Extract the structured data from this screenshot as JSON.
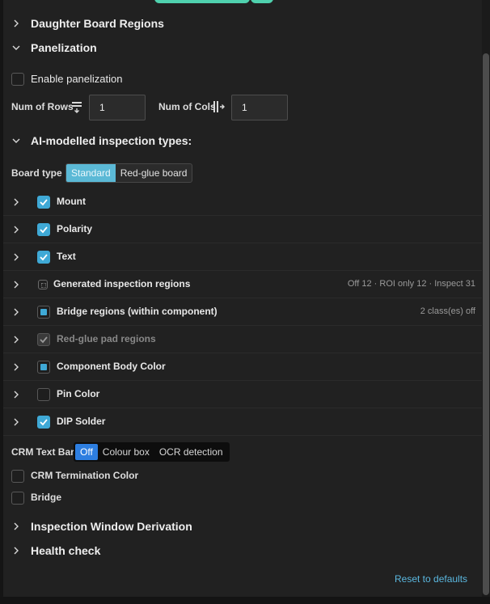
{
  "sections": {
    "daughter_board": "Daughter Board Regions",
    "panelization": "Panelization",
    "ai_types": "AI-modelled inspection types:",
    "inspection_window": "Inspection Window Derivation",
    "health_check": "Health check"
  },
  "panelization": {
    "enable_label": "Enable panelization",
    "rows_label": "Num of Rows",
    "rows_value": "1",
    "cols_label": "Num of Cols",
    "cols_value": "1"
  },
  "board_type": {
    "label": "Board type",
    "options": [
      "Standard",
      "Red-glue board"
    ],
    "selected": "Standard"
  },
  "inspection_rows": [
    {
      "label": "Mount",
      "state": "checked",
      "meta": ""
    },
    {
      "label": "Polarity",
      "state": "checked",
      "meta": ""
    },
    {
      "label": "Text",
      "state": "checked",
      "meta": ""
    },
    {
      "label": "Generated inspection regions",
      "state": "dotted",
      "meta": "Off 12 · ROI only 12 · Inspect 31"
    },
    {
      "label": "Bridge regions (within component)",
      "state": "partial",
      "meta": "2 class(es) off"
    },
    {
      "label": "Red-glue pad regions",
      "state": "disabled",
      "meta": ""
    },
    {
      "label": "Component Body Color",
      "state": "partial",
      "meta": ""
    },
    {
      "label": "Pin Color",
      "state": "unchecked",
      "meta": ""
    },
    {
      "label": "DIP Solder",
      "state": "checked",
      "meta": ""
    }
  ],
  "crm": {
    "label": "CRM Text Bar",
    "options": [
      "Off",
      "Colour box",
      "OCR detection"
    ],
    "selected": "Off",
    "termination_label": "CRM Termination Color",
    "bridge_label": "Bridge"
  },
  "reset_label": "Reset to defaults",
  "colors": {
    "accent": "#3fa9d6",
    "active_segment": "#5bb9d6",
    "crm_active": "#2d7ee0",
    "link": "#5bb8e0",
    "top_button": "#4fd1ae"
  }
}
